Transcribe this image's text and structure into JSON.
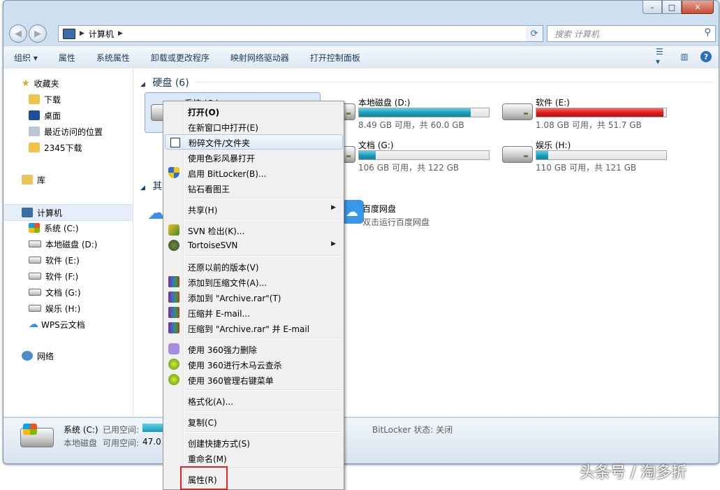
{
  "address": {
    "path": "计算机",
    "search_placeholder": "搜索 计算机"
  },
  "toolbar": [
    "组织 ▾",
    "属性",
    "系统属性",
    "卸载或更改程序",
    "映射网络驱动器",
    "打开控制面板"
  ],
  "sidebar": {
    "favorites": "收藏夹",
    "downloads": "下载",
    "desktop": "桌面",
    "recent": "最近访问的位置",
    "dl2345": "2345下载",
    "libraries": "库",
    "computer": "计算机",
    "drives": [
      "系统 (C:)",
      "本地磁盘 (D:)",
      "软件 (E:)",
      "软件 (F:)",
      "文档 (G:)",
      "娱乐 (H:)"
    ],
    "wps": "WPS云文档",
    "network": "网络"
  },
  "groups": {
    "hdd": "硬盘 (6)",
    "other": "其他"
  },
  "drives": [
    {
      "name": "系统 (C:)"
    },
    {
      "name": "本地磁盘 (D:)",
      "info": "8.49 GB 可用，共 60.0 GB",
      "used": 0.86
    },
    {
      "name": "软件 (E:)",
      "info": "1.08 GB 可用，共 51.7 GB",
      "used": 0.98
    },
    {
      "name": "文档 (G:)",
      "info": "106 GB 可用，共 122 GB",
      "used": 0.13
    },
    {
      "name": "娱乐 (H:)",
      "info": "110 GB 可用，共 121 GB",
      "used": 0.09
    }
  ],
  "baidu": {
    "name": "百度网盘",
    "desc": "双击运行百度网盘"
  },
  "details": {
    "name": "系统 (C:)",
    "used_lbl": "已用空间:",
    "type": "本地磁盘",
    "free_lbl": "可用空间:",
    "free": "47.0 G",
    "bitlocker": "BitLocker 状态: 关闭"
  },
  "menu": {
    "open": "打开(O)",
    "open_new": "在新窗口中打开(E)",
    "shred": "粉碎文件/文件夹",
    "color": "使用色彩风暴打开",
    "bitlocker": "启用 BitLocker(B)...",
    "diamond": "钻石看图王",
    "share": "共享(H)",
    "svn_checkout": "SVN 检出(K)...",
    "tortoise": "TortoiseSVN",
    "restore": "还原以前的版本(V)",
    "add_archive": "添加到压缩文件(A)...",
    "add_rar": "添加到 \"Archive.rar\"(T)",
    "zip_email": "压缩并 E-mail...",
    "zip_rar_email": "压缩到 \"Archive.rar\" 并 E-mail",
    "del360": "使用 360强力删除",
    "scan360": "使用 360进行木马云查杀",
    "menu360": "使用 360管理右键菜单",
    "format": "格式化(A)...",
    "copy": "复制(C)",
    "shortcut": "创建快捷方式(S)",
    "rename": "重命名(M)",
    "properties": "属性(R)"
  },
  "watermark": "头条号 / 淘多折",
  "colors": {
    "accent": "#1e395b",
    "highlight_box": "#e02424",
    "bar_blue": "#1a9ab8",
    "bar_red": "#dc1b1b"
  }
}
